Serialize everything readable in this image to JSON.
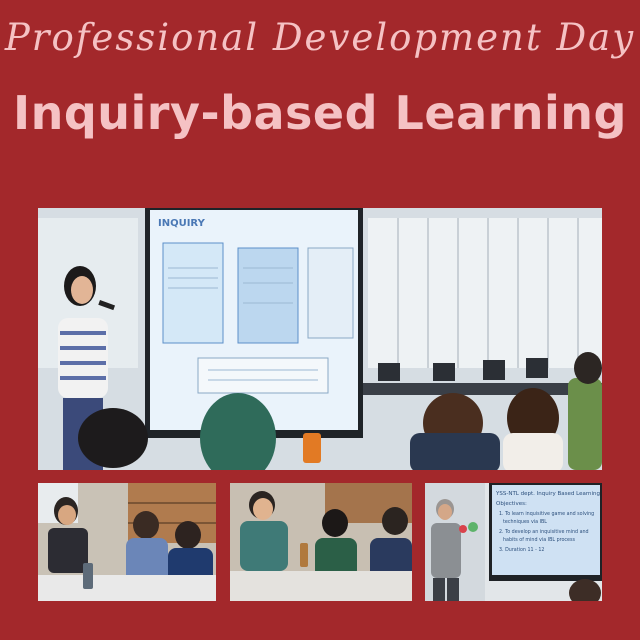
{
  "header": {
    "subtitle": "Professional Development Day",
    "title": "Inquiry-based Learning"
  },
  "photos": {
    "main": {
      "slide_heading": "INQUIRY"
    },
    "c": {
      "slide_title": "YSS-NTL dept. Inquiry Based Learning",
      "slide_label": "Objectives:",
      "slide_line1": "1. To learn inquisitive game and solving",
      "slide_line2": "techniques via IBL",
      "slide_line3": "2. To develop an inquisitive mind and",
      "slide_line4": "habits of mind via IBL process",
      "slide_line5": "3. Duration 11 - 12"
    }
  },
  "colors": {
    "background": "#a3282b",
    "title_text": "#f5c2c4"
  }
}
